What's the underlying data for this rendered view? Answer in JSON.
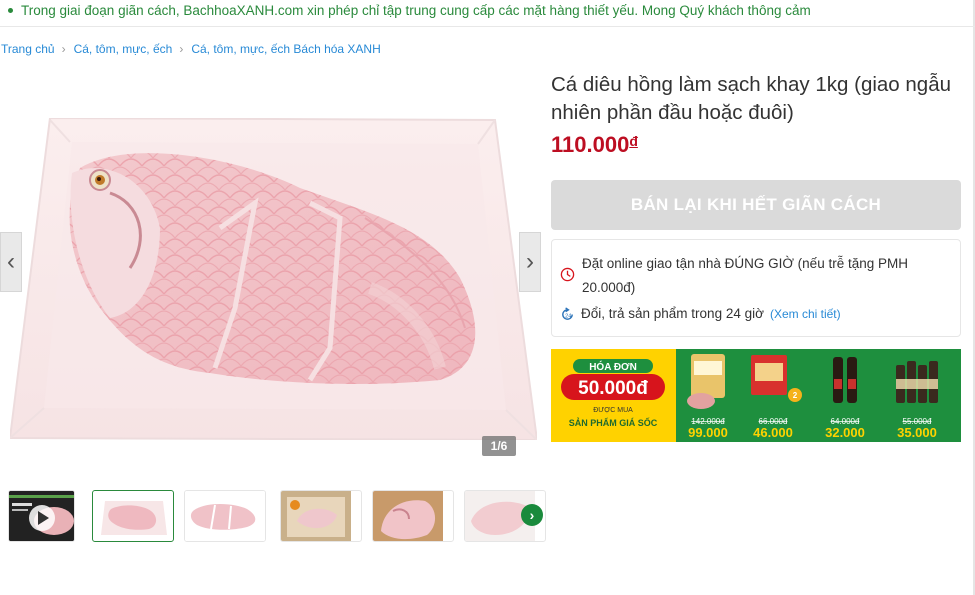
{
  "notice": {
    "text": "Trong giai đoạn giãn cách, BachhoaXANH.com xin phép chỉ tập trung cung cấp các mặt hàng thiết yếu. Mong Quý khách thông cảm"
  },
  "breadcrumb": {
    "items": [
      {
        "label": "Trang chủ"
      },
      {
        "label": "Cá, tôm, mực, ếch"
      },
      {
        "label": "Cá, tôm, mực, ếch Bách hóa XANH"
      }
    ],
    "separator": "›"
  },
  "gallery": {
    "counter": "1/6",
    "prev_icon": "chevron-left-icon",
    "next_icon": "chevron-right-icon",
    "thumbnails": [
      {
        "kind": "video",
        "icon": "play-icon"
      },
      {
        "kind": "image",
        "active": true
      },
      {
        "kind": "image"
      },
      {
        "kind": "image"
      },
      {
        "kind": "image"
      },
      {
        "kind": "image"
      }
    ],
    "thumb_next_icon": "chevron-right-icon"
  },
  "product": {
    "title": "Cá diêu hồng làm sạch khay 1kg (giao ngẫu nhiên phần đầu hoặc đuôi)",
    "price": "110.000",
    "currency": "đ"
  },
  "buy_button": {
    "label": "BÁN LẠI KHI HẾT GIÃN CÁCH"
  },
  "policies": {
    "delivery": "Đặt online giao tận nhà ĐÚNG GIỜ (nếu trễ tặng PMH 20.000đ)",
    "return": "Đổi, trả sản phẩm trong 24 giờ",
    "return_detail": "(Xem chi tiết)"
  },
  "promo_banner": {
    "headline": "HÓA ĐƠN",
    "amount": "50.000đ",
    "subtitle": "ĐƯỢC MUA",
    "caption": "SẢN PHẨM GIÁ SỐC",
    "deals": [
      {
        "old_price": "142.000đ",
        "new_price": "99.000",
        "currency": "đ"
      },
      {
        "old_price": "66.000đ",
        "new_price": "46.000",
        "currency": "đ"
      },
      {
        "old_price": "64.000đ",
        "new_price": "32.000",
        "currency": "đ"
      },
      {
        "old_price": "55.000đ",
        "new_price": "35.000",
        "currency": "đ"
      }
    ],
    "colors": {
      "green": "#1e8f3e",
      "yellow": "#ffd200",
      "red": "#d7141c"
    }
  },
  "colors": {
    "brand_green": "#2a8a3c",
    "price_red": "#bd0e22",
    "link_blue": "#288ad6"
  }
}
